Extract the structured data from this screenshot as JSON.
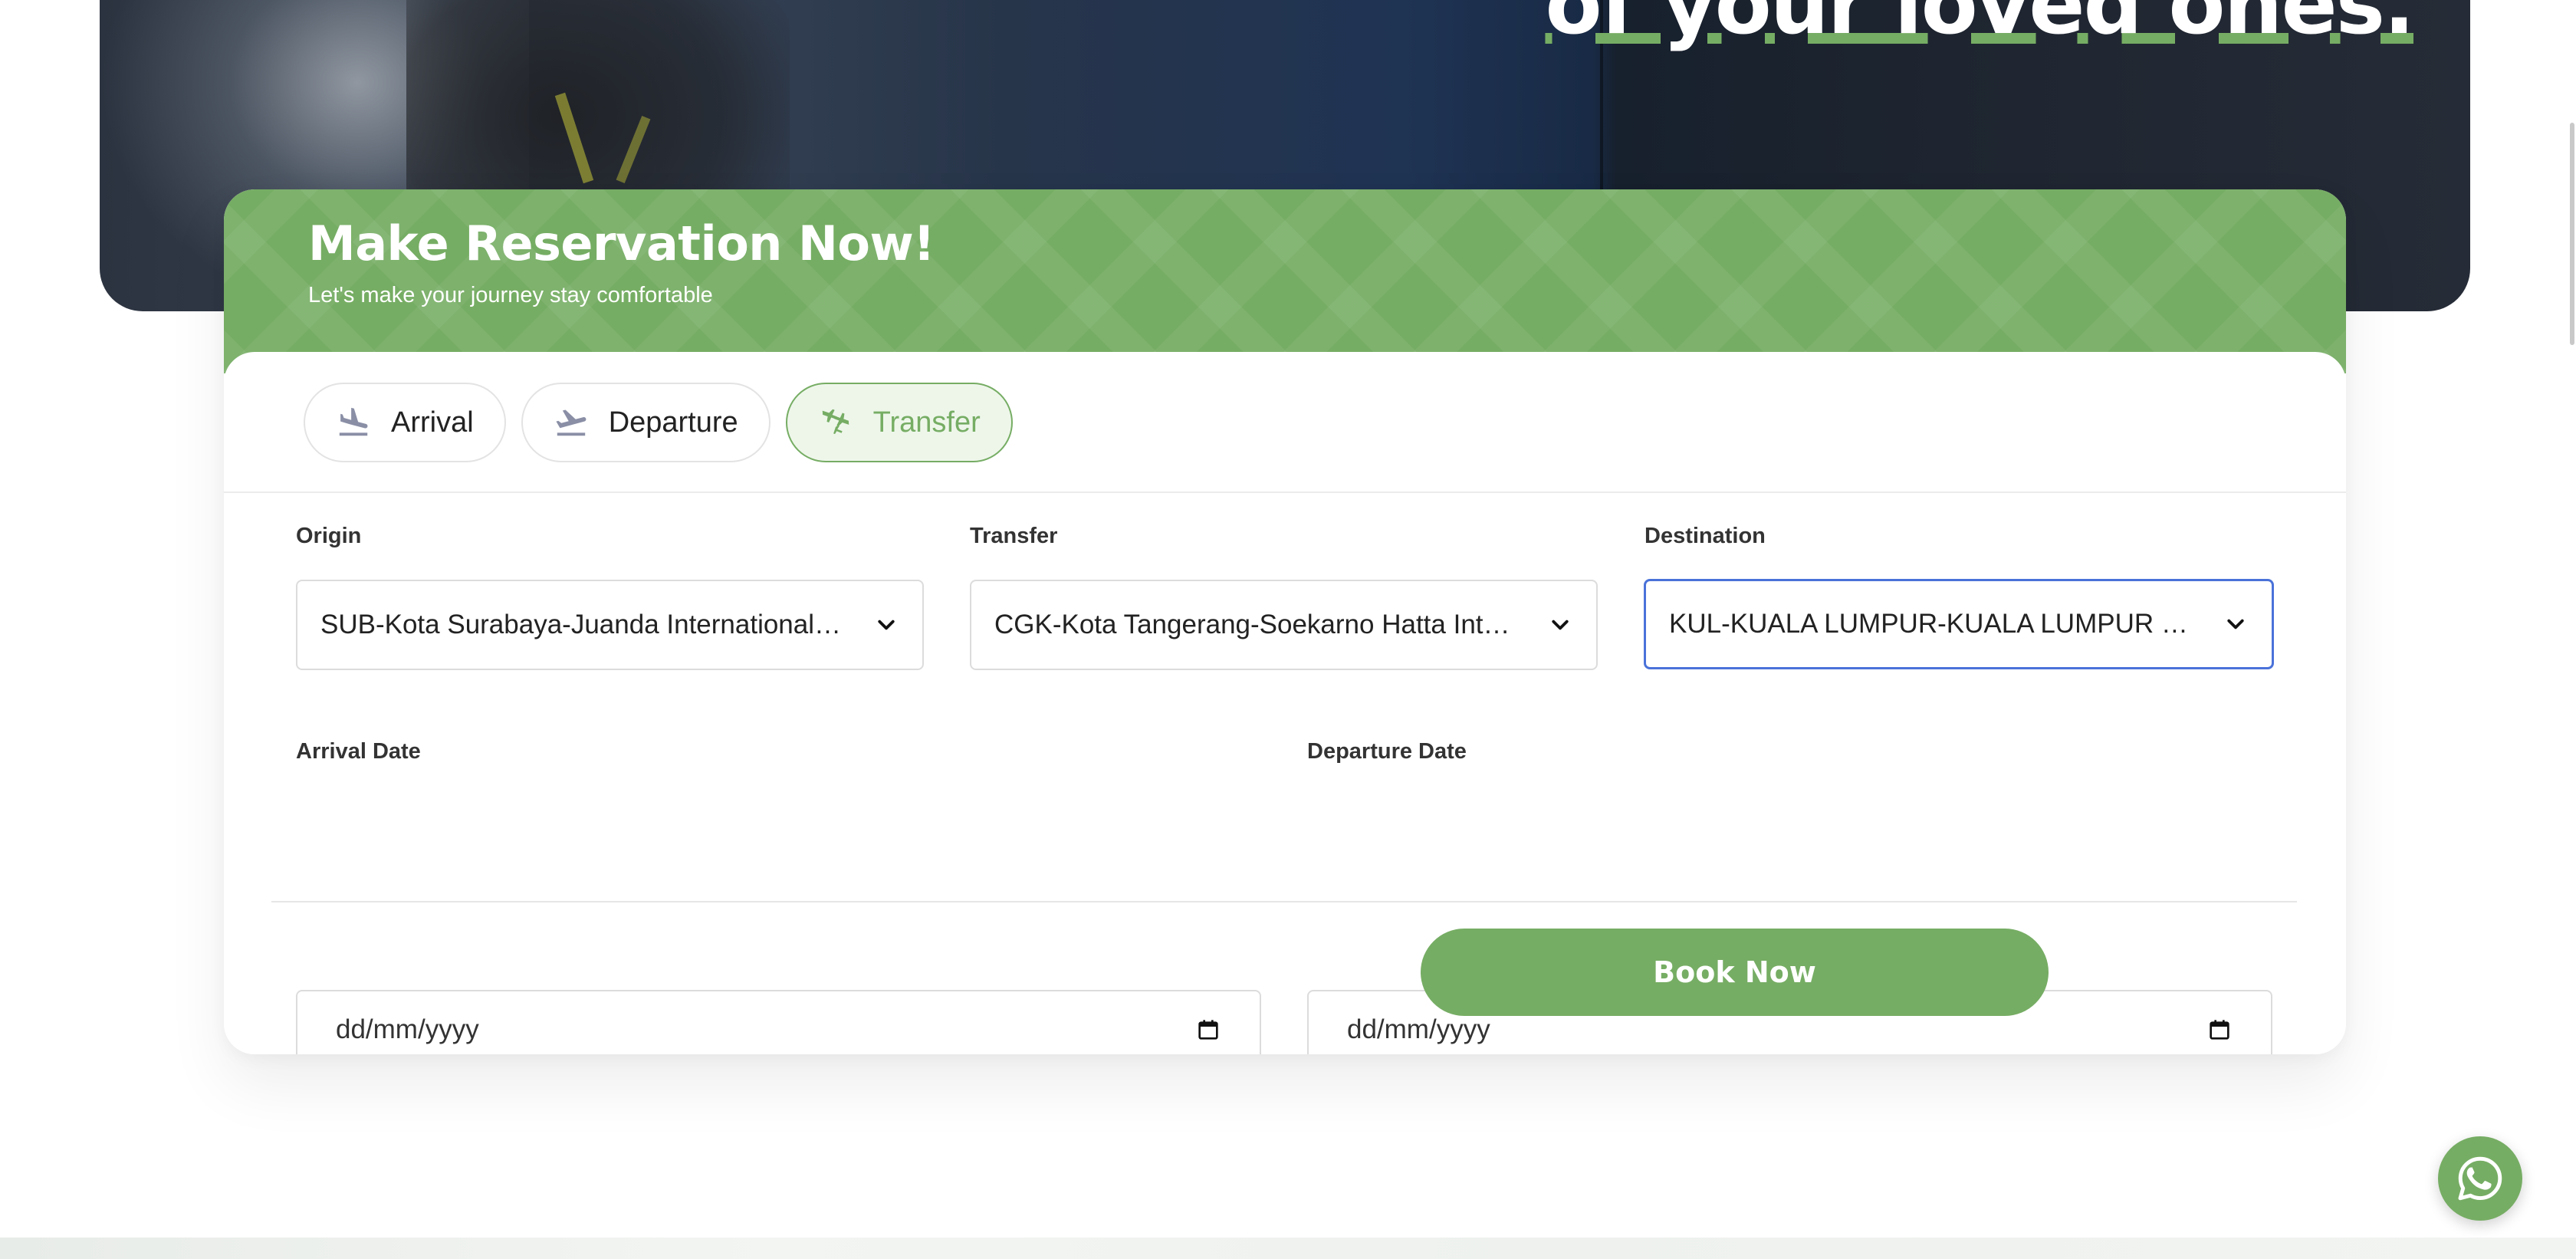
{
  "hero": {
    "headline": "of your loved ones."
  },
  "reservation": {
    "title": "Make Reservation Now!",
    "subtitle": "Let's make your journey stay comfortable",
    "tabs": [
      {
        "label": "Arrival",
        "icon": "plane-landing-icon",
        "active": false
      },
      {
        "label": "Departure",
        "icon": "plane-takeoff-icon",
        "active": false
      },
      {
        "label": "Transfer",
        "icon": "plane-transfer-icon",
        "active": true
      }
    ],
    "origin": {
      "label": "Origin",
      "value": "SUB-Kota Surabaya-Juanda International Airport"
    },
    "transfer": {
      "label": "Transfer",
      "value": "CGK-Kota Tangerang-Soekarno Hatta International Airport"
    },
    "destination": {
      "label": "Destination",
      "value": "KUL-KUALA LUMPUR-KUALA LUMPUR INTERNATIONAL AIRPORT"
    },
    "arrival_date": {
      "label": "Arrival Date",
      "placeholder": "dd/mm/yyyy"
    },
    "departure_date": {
      "label": "Departure Date",
      "placeholder": "dd/mm/yyyy"
    },
    "book_label": "Book Now"
  },
  "colors": {
    "brand_green": "#76ad64",
    "focus_blue": "#4a72d9"
  },
  "floating": {
    "icon": "whatsapp-icon"
  }
}
